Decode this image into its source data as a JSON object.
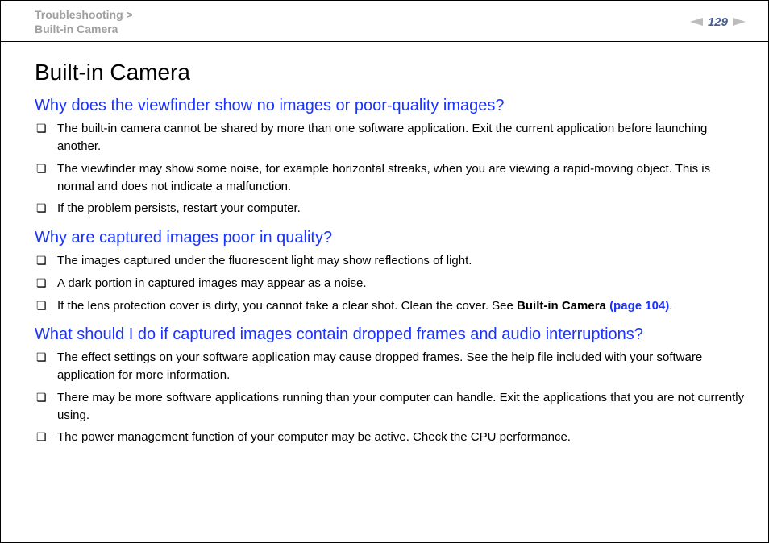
{
  "header": {
    "breadcrumb_line1": "Troubleshooting >",
    "breadcrumb_line2": "Built-in Camera",
    "page_number": "129"
  },
  "main": {
    "title": "Built-in Camera",
    "sections": [
      {
        "heading": "Why does the viewfinder show no images or poor-quality images?",
        "items": [
          {
            "text": "The built-in camera cannot be shared by more than one software application. Exit the current application before launching another."
          },
          {
            "text": "The viewfinder may show some noise, for example horizontal streaks, when you are viewing a rapid-moving object. This is normal and does not indicate a malfunction."
          },
          {
            "text": "If the problem persists, restart your computer."
          }
        ]
      },
      {
        "heading": "Why are captured images poor in quality?",
        "items": [
          {
            "text": "The images captured under the fluorescent light may show reflections of light."
          },
          {
            "text": "A dark portion in captured images may appear as a noise."
          },
          {
            "text_pre": "If the lens protection cover is dirty, you cannot take a clear shot. Clean the cover. See ",
            "bold": "Built-in Camera ",
            "link": "(page 104)",
            "text_post": "."
          }
        ]
      },
      {
        "heading": "What should I do if captured images contain dropped frames and audio interruptions?",
        "items": [
          {
            "text": "The effect settings on your software application may cause dropped frames. See the help file included with your software application for more information."
          },
          {
            "text": "There may be more software applications running than your computer can handle. Exit the applications that you are not currently using."
          },
          {
            "text": "The power management function of your computer may be active. Check the CPU performance."
          }
        ]
      }
    ]
  }
}
